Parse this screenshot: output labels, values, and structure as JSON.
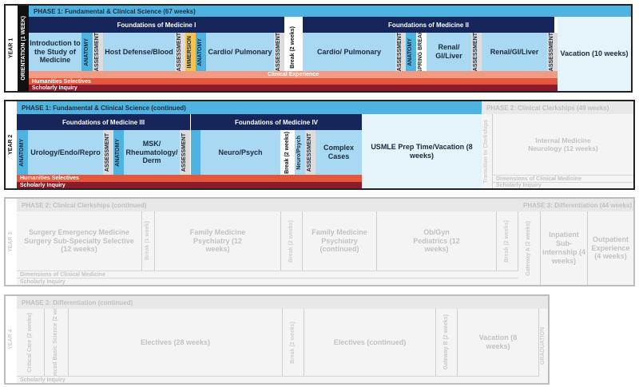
{
  "year1": {
    "year_label": "YEAR 1",
    "orientation": "ORIENTATION (1 WEEK)",
    "phase": "PHASE 1: Fundamental & Clinical Science (67 weeks)",
    "fom1": "Foundations of Medicine I",
    "fom2": "Foundations of Medicine II",
    "intro": "Introduction to the Study of Medicine",
    "anatomy": "ANATOMY",
    "assessment": "ASSESSMENT",
    "host": "Host Defense/Blood",
    "immersion": "IMMERSION",
    "cardio": "Cardio/ Pulmonary",
    "brk": "Break (2 weeks)",
    "cardio2": "Cardio/ Pulmonary",
    "spring": "SPRING BREAK",
    "renal": "Renal/ GI/Liver",
    "renal2": "Renal/GI/Liver",
    "vacation": "Vacation (10 weeks)",
    "clinical": "Clinical Experience",
    "humanities": "Humanities Selectives",
    "scholarly": "Scholarly Inquiry"
  },
  "year2": {
    "year_label": "YEAR 2",
    "phase": "PHASE 1: Fundamental & Clinical Science (continued)",
    "phase2": "PHASE 2: Clinical Clerkships (49 weeks)",
    "fom3": "Foundations of Medicine III",
    "fom4": "Foundations of Medicine IV",
    "anatomy": "ANATOMY",
    "assessment": "ASSESSMENT",
    "uro": "Urology/Endo/Repro",
    "msk": "MSK/ Rheumatology/ Derm",
    "neuro": "Neuro/Psych",
    "brk": "Break (2 weeks)",
    "neuro2": "Neuro/Psych",
    "complex": "Complex Cases",
    "usmle": "USMLE Prep Time/Vacation (8 weeks)",
    "transition": "Transition to Clerkships",
    "im": "Internal Medicine Neurology (12 weeks)",
    "dims": "Dimensions of Clinical Medicine",
    "humanities": "Humanities Selectives",
    "scholarly": "Scholarly Inquiry",
    "scholarly_gray": "Scholarly Inquiry"
  },
  "year3": {
    "year_label": "YEAR 3",
    "phase": "PHASE 2: Clinical Clerkships (continued)",
    "phase3": "PHASE 3: Differentiation (44 weeks)",
    "surgery": "Surgery Emergency Medicine Surgery Sub-Specialty Selective (12 weeks)",
    "break1": "Break (1 week)",
    "fm": "Family Medicine Psychiatry (12 weeks)",
    "break2": "Break (2 weeks)",
    "fm2": "Family Medicine Psychiatry (continued)",
    "obgyn": "Ob/Gyn Pediatrics (12 weeks)",
    "break3": "Break (2 weeks)",
    "gateway": "Gateway A (2 weeks)",
    "inpatient": "Inpatient Sub-internship (4 weeks)",
    "outpatient": "Outpatient Experience (4 weeks)",
    "dims": "Dimensions of Clinical Medicine",
    "scholarly": "Scholarly Inquiry"
  },
  "year4": {
    "year_label": "YEAR 4",
    "phase": "PHASE 3: Differentiation (continued)",
    "critical": "Critical Care (2 weeks)",
    "advanced": "Advanced Basic Science (2 weeks)",
    "electives": "Electives (28 weeks)",
    "brk": "Break (2 weeks)",
    "electives2": "Electives (continued)",
    "gatewayb": "Gateway B (2 weeks)",
    "vacation": "Vacation (8 weeks)",
    "graduation": "GRADUATION",
    "scholarly": "Scholarly Inquiry"
  },
  "colors": {
    "navy": "#16255a",
    "blue": "#4fb3e2",
    "light_blue": "#a9d9f2",
    "clinical": "#f29b83",
    "humanities": "#e5573d",
    "scholarly": "#8b1a2a",
    "immersion": "#f6c34c"
  }
}
